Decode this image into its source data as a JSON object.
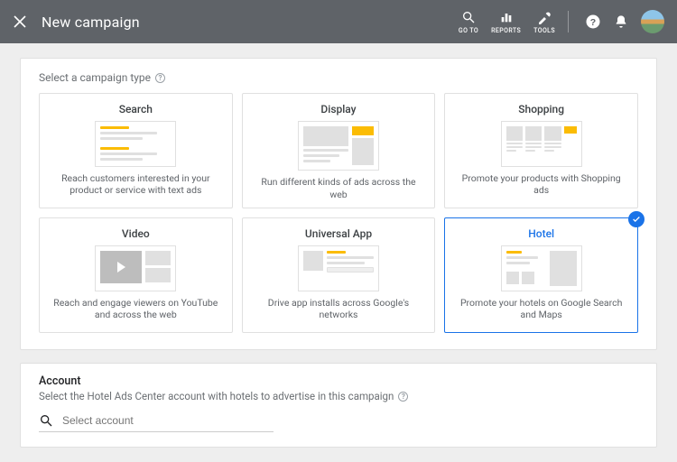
{
  "header": {
    "title": "New campaign",
    "tools": [
      {
        "label": "GO TO",
        "icon": "search"
      },
      {
        "label": "REPORTS",
        "icon": "reports"
      },
      {
        "label": "TOOLS",
        "icon": "tools"
      }
    ]
  },
  "campaignTypes": {
    "label": "Select a campaign type",
    "cards": [
      {
        "title": "Search",
        "desc": "Reach customers interested in your product or service with text ads"
      },
      {
        "title": "Display",
        "desc": "Run different kinds of ads across the web"
      },
      {
        "title": "Shopping",
        "desc": "Promote your products with Shopping ads"
      },
      {
        "title": "Video",
        "desc": "Reach and engage viewers on YouTube and across the web"
      },
      {
        "title": "Universal App",
        "desc": "Drive app installs across Google's networks"
      },
      {
        "title": "Hotel",
        "desc": "Promote your hotels on Google Search and Maps"
      }
    ],
    "selectedIndex": 5
  },
  "account": {
    "title": "Account",
    "sub": "Select the Hotel Ads Center account with hotels to advertise in this campaign",
    "placeholder": "Select account"
  }
}
